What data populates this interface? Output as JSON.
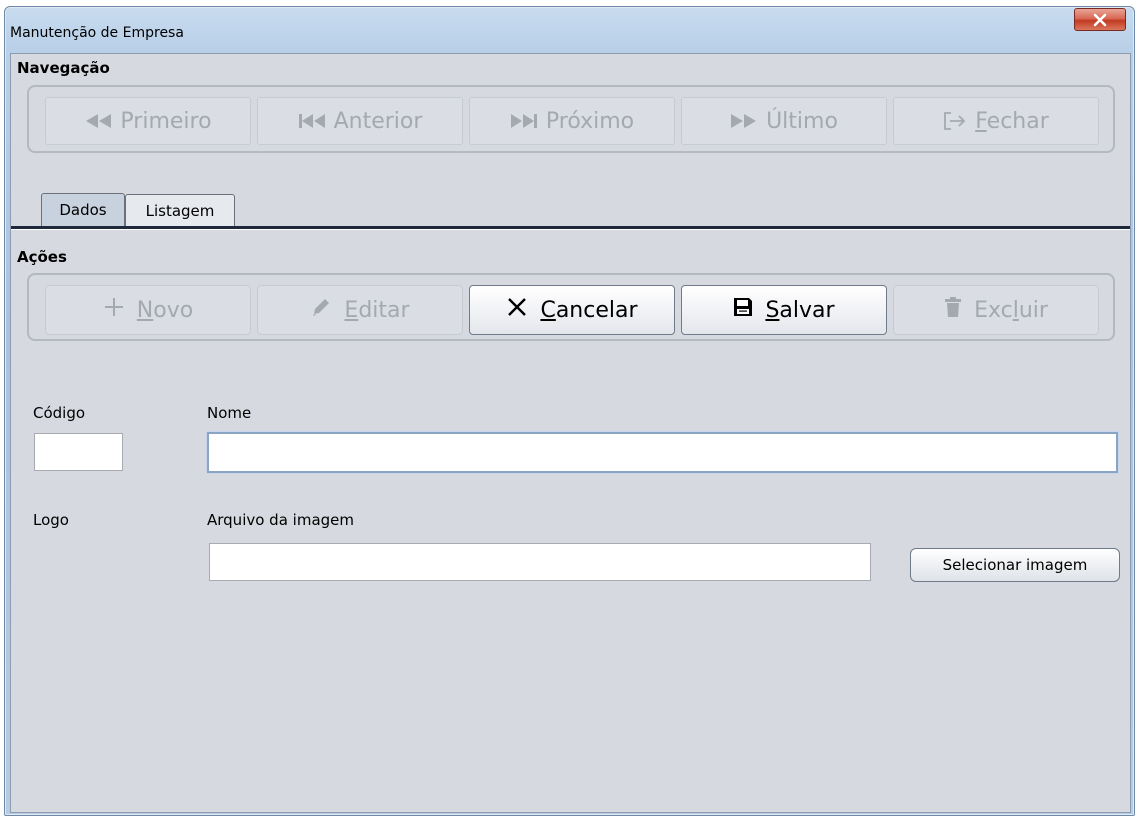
{
  "window": {
    "title": "Manutenção de Empresa"
  },
  "navigation": {
    "group_title": "Navegação",
    "buttons": [
      {
        "label": "Primeiro",
        "icon": "rewind-icon"
      },
      {
        "label": "Anterior",
        "icon": "skip-back-icon"
      },
      {
        "label": "Próximo",
        "icon": "skip-forward-icon"
      },
      {
        "label": "Último",
        "icon": "fast-forward-icon"
      },
      {
        "label_prefix": "",
        "mnemonic": "F",
        "label_rest": "echar",
        "icon": "exit-icon"
      }
    ]
  },
  "tabs": [
    {
      "label": "Dados",
      "active": true
    },
    {
      "label": "Listagem",
      "active": false
    }
  ],
  "actions": {
    "group_title": "Ações",
    "buttons": [
      {
        "mnemonic": "N",
        "label_rest": "ovo",
        "icon": "plus-icon",
        "enabled": false
      },
      {
        "mnemonic": "E",
        "label_rest": "ditar",
        "icon": "pencil-icon",
        "enabled": false
      },
      {
        "mnemonic": "C",
        "label_rest": "ancelar",
        "icon": "x-icon",
        "enabled": true
      },
      {
        "mnemonic": "S",
        "label_rest": "alvar",
        "icon": "floppy-icon",
        "enabled": true
      },
      {
        "label_prefix": "Exc",
        "mnemonic": "l",
        "label_rest": "uir",
        "icon": "trash-icon",
        "enabled": false
      }
    ]
  },
  "form": {
    "codigo_label": "Código",
    "codigo_value": "",
    "nome_label": "Nome",
    "nome_value": "",
    "logo_label": "Logo",
    "arquivo_label": "Arquivo da imagem",
    "arquivo_value": "",
    "select_image_label": "Selecionar imagem"
  },
  "colors": {
    "client_bg": "#d6d9df",
    "disabled_text": "#a4a9b1",
    "close_button": "#c23b22"
  }
}
